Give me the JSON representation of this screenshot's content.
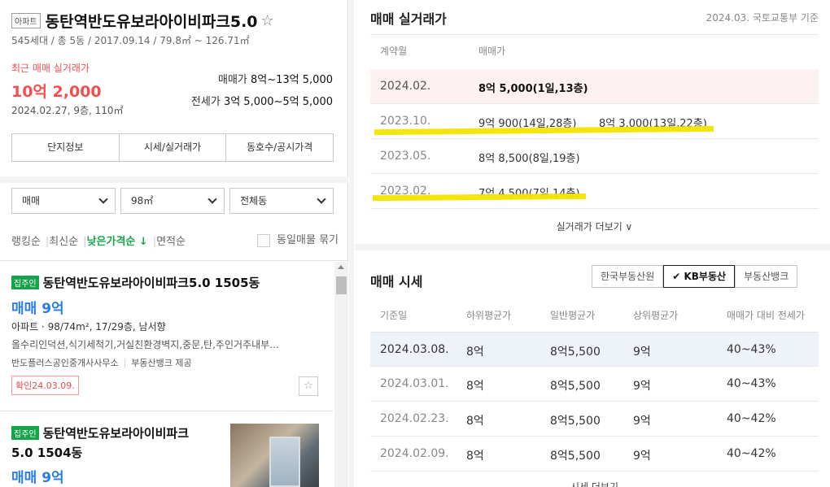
{
  "complex": {
    "type_badge": "아파트",
    "name": "동탄역반도유보라아이비파크5.0",
    "star": "☆",
    "meta": "545세대 / 총 5동 / 2017.09.14 / 79.8㎡ ~ 126.71㎡",
    "recent_label": "최근 매매 실거래가",
    "recent_price": "10억 2,000",
    "recent_date": "2024.02.27, 9층, 110㎡",
    "sale_label": "매매가",
    "sale_range": "8억~13억 5,000",
    "jeonse_label": "전세가",
    "jeonse_range": "3억 5,000~5억 5,000",
    "tabs": [
      "단지정보",
      "시세/실거래가",
      "동호수/공시가격"
    ]
  },
  "filters": {
    "trade": "매매",
    "area": "98㎡",
    "dong": "전체동"
  },
  "sort": {
    "items": [
      "랭킹순",
      "최신순",
      "낮은가격순 ↓",
      "면적순"
    ],
    "same_listing": "동일매물 묶기"
  },
  "listings": [
    {
      "tag": "집주인",
      "title": "동탄역반도유보라아이비파크5.0 1505동",
      "price": "매매 9억",
      "spec": "아파트 · 98/74m², 17/29층, 남서향",
      "desc": "올수리인덕션,식기세척기,거실친환경벽지,중문,탄,주인거주내부…",
      "agent": "반도플러스공인중개사사무소",
      "provider": "부동산뱅크 제공",
      "confirm": "확인24.03.09."
    },
    {
      "tag": "집주인",
      "title_line1": "동탄역반도유보라아이비파크",
      "title_line2": "5.0 1504동",
      "price": "매매 9억"
    }
  ],
  "transactions": {
    "title": "매매 실거래가",
    "source": "2024.03. 국토교통부 기준",
    "col_month": "계약월",
    "col_price": "매매가",
    "rows": [
      {
        "date": "2024.02.",
        "p1": "8억 5,000(1일,13층)",
        "p2": ""
      },
      {
        "date": "2023.10.",
        "p1": "9억 900(14일,28층)",
        "p2": "8억 3,000(13일,22층)"
      },
      {
        "date": "2023.05.",
        "p1": "8억 8,500(8일,19층)",
        "p2": ""
      },
      {
        "date": "2023.02.",
        "p1": "7억 4,500(7일,14층)",
        "p2": ""
      }
    ],
    "more": "실거래가 더보기 ∨"
  },
  "market": {
    "title": "매매 시세",
    "sources": [
      "한국부동산원",
      "✔ KB부동산",
      "부동산뱅크"
    ],
    "headers": [
      "기준일",
      "하위평균가",
      "일반평균가",
      "상위평균가",
      "매매가 대비 전세가"
    ],
    "rows": [
      [
        "2024.03.08.",
        "8억",
        "8억5,500",
        "9억",
        "40~43%"
      ],
      [
        "2024.03.01.",
        "8억",
        "8억5,500",
        "9억",
        "40~43%"
      ],
      [
        "2024.02.23.",
        "8억",
        "8억5,500",
        "9억",
        "40~42%"
      ],
      [
        "2024.02.09.",
        "8억",
        "8억5,500",
        "9억",
        "40~42%"
      ]
    ],
    "more": "시세 더보기"
  },
  "colors": {
    "accent_red": "#f05050",
    "accent_blue": "#2b7de1",
    "accent_green": "#16a34a",
    "highlight_yellow": "#f4e400"
  }
}
